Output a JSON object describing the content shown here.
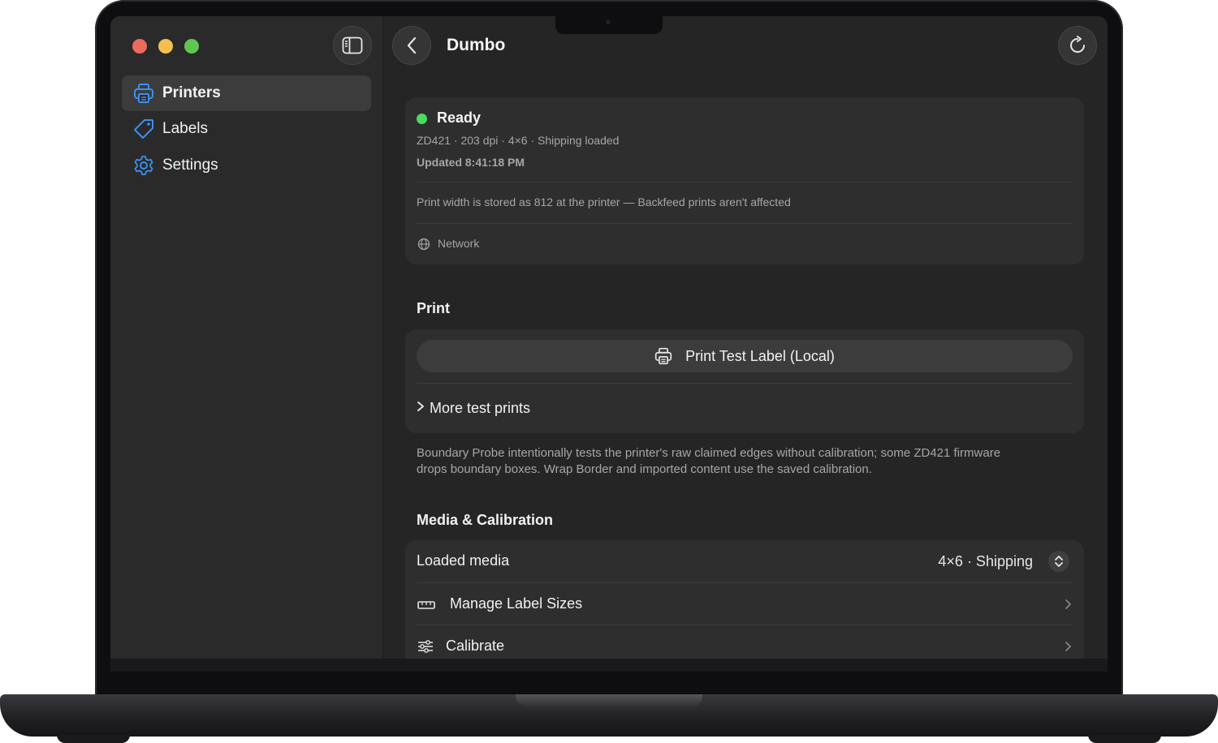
{
  "window": {
    "title": "Dumbo"
  },
  "sidebar": {
    "items": [
      {
        "label": "Printers",
        "icon": "printer-icon",
        "selected": true
      },
      {
        "label": "Labels",
        "icon": "tag-icon",
        "selected": false
      },
      {
        "label": "Settings",
        "icon": "gear-icon",
        "selected": false
      }
    ]
  },
  "status": {
    "state": "Ready",
    "state_color": "#4cd964",
    "details": "ZD421 · 203 dpi · 4×6 · Shipping loaded",
    "updated": "Updated 8:41:18 PM",
    "note": "Print width is stored as 812 at the printer — Backfeed prints aren't affected",
    "connection": "Network"
  },
  "print": {
    "heading": "Print",
    "test_button": "Print Test Label (Local)",
    "more_label": "More test prints",
    "footnote_line1": "Boundary Probe intentionally tests the printer's raw claimed edges without calibration; some ZD421 firmware",
    "footnote_line2": "drops boundary boxes. Wrap Border and imported content use the saved calibration."
  },
  "media": {
    "heading": "Media & Calibration",
    "loaded_label": "Loaded media",
    "loaded_value": "4×6 · Shipping",
    "manage_label": "Manage Label Sizes",
    "calibrate_label": "Calibrate"
  },
  "colors": {
    "accent": "#3b8ff0",
    "background": "#252525",
    "card": "#2e2e2e"
  }
}
